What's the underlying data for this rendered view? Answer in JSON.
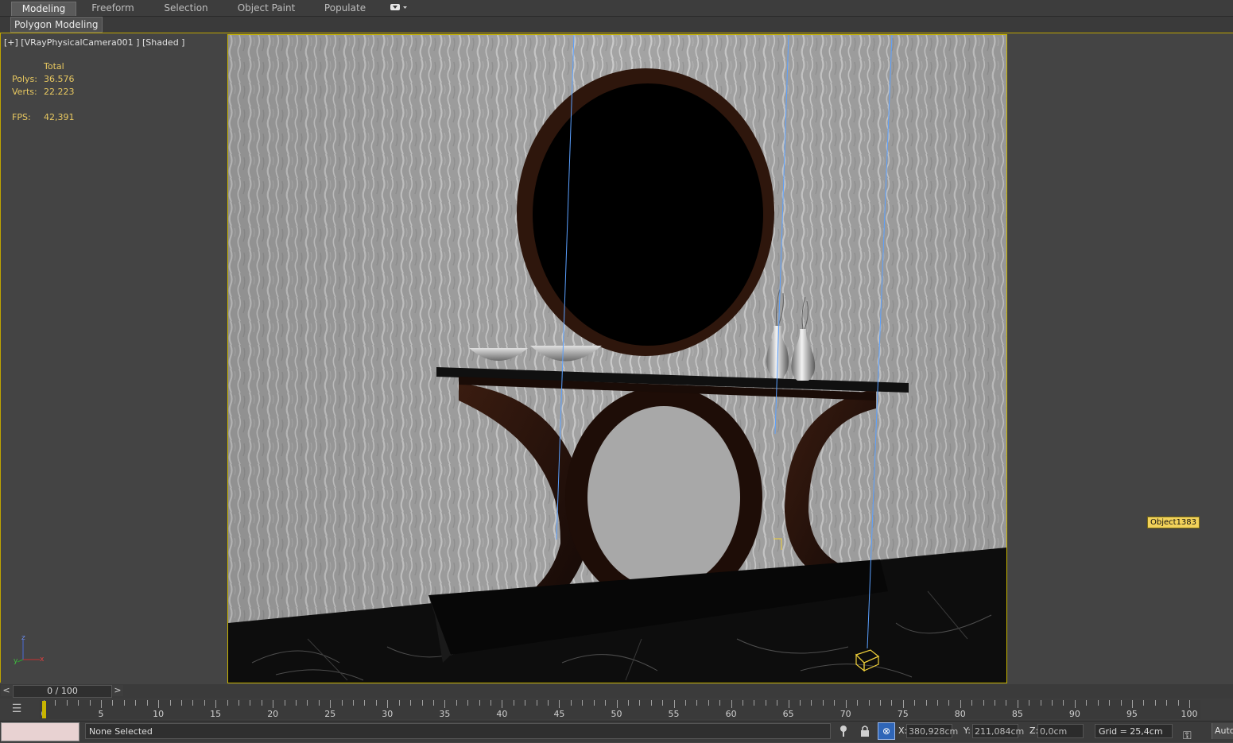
{
  "ribbon": {
    "tabs": [
      "Modeling",
      "Freeform",
      "Selection",
      "Object Paint",
      "Populate"
    ],
    "active_tab": "Modeling",
    "sub_panel": "Polygon Modeling"
  },
  "viewport": {
    "label": "[+] [VRayPhysicalCamera001 ] [Shaded ]",
    "stats": {
      "header": "Total",
      "polys_label": "Polys:",
      "polys_value": "36.576",
      "verts_label": "Verts:",
      "verts_value": "22.223",
      "fps_label": "FPS:",
      "fps_value": "42,391"
    },
    "object_label": "Object1383",
    "axis": {
      "z": "z",
      "x": "x",
      "y": "y"
    },
    "border_color": "#c8b400"
  },
  "timeline": {
    "frame_display": "0 / 100",
    "prev": "<",
    "next": ">",
    "tick_labels": [
      "0",
      "5",
      "10",
      "15",
      "20",
      "25",
      "30",
      "35",
      "40",
      "45",
      "50",
      "55",
      "60",
      "65",
      "70",
      "75",
      "80",
      "85",
      "90",
      "95",
      "100"
    ]
  },
  "status": {
    "selection": "None Selected",
    "x_label": "X:",
    "x_value": "380,928cm",
    "y_label": "Y:",
    "y_value": "211,084cm",
    "z_label": "Z:",
    "z_value": "0,0cm",
    "grid": "Grid = 25,4cm",
    "auto_label": "Auto"
  }
}
